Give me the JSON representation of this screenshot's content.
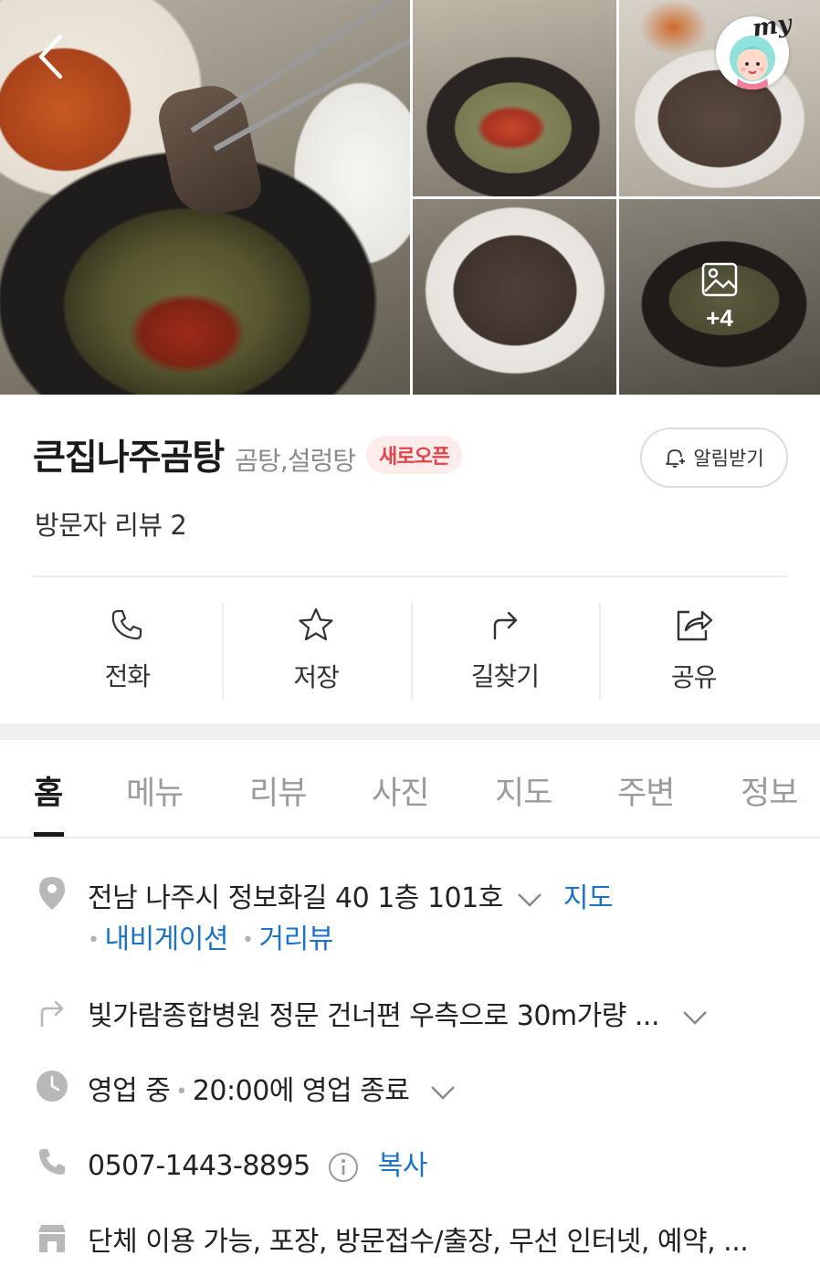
{
  "gallery": {
    "more_count": "+4"
  },
  "header": {
    "my_label": "my",
    "place_name": "큰집나주곰탕",
    "category": "곰탕,설렁탕",
    "badge": "새로오픈",
    "notify_label": "알림받기",
    "review_summary": "방문자 리뷰 2"
  },
  "actions": [
    {
      "label": "전화",
      "icon": "phone-icon"
    },
    {
      "label": "저장",
      "icon": "star-icon"
    },
    {
      "label": "길찾기",
      "icon": "directions-icon"
    },
    {
      "label": "공유",
      "icon": "share-icon"
    }
  ],
  "tabs": [
    "홈",
    "메뉴",
    "리뷰",
    "사진",
    "지도",
    "주변",
    "정보"
  ],
  "active_tab": "홈",
  "info": {
    "address": "전남 나주시 정보화길 40 1층 101호",
    "map_link": "지도",
    "navigation_link": "내비게이션",
    "street_view_link": "거리뷰",
    "directions_text": "빛가람종합병원 정문 건너편 우측으로 30m가량 ...",
    "status": "영업 중",
    "closing": "20:00에 영업 종료",
    "phone": "0507-1443-8895",
    "copy_link": "복사",
    "amenities": "단체 이용 가능, 포장, 방문접수/출장, 무선 인터넷, 예약, ..."
  },
  "colors": {
    "accent_blue": "#1a73c8",
    "badge_red": "#e3454a",
    "icon_gray": "#b8b8b8"
  }
}
